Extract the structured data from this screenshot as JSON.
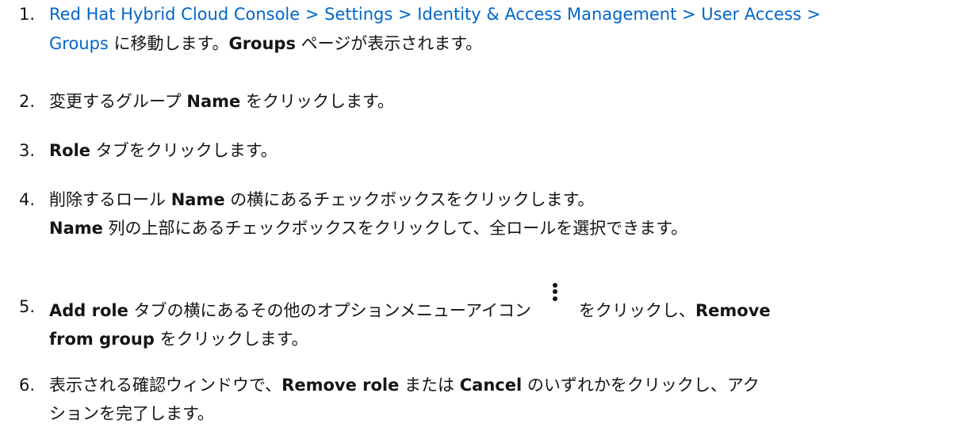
{
  "steps": [
    {
      "number": "1.",
      "breadcrumb": "Red Hat Hybrid Cloud Console > Settings > Identity & Access Management > User Access >",
      "breadcrumb_end": "Groups",
      "text_a": " に移動します。",
      "bold_a": "Groups",
      "text_b": " ページが表示されます。"
    },
    {
      "number": "2.",
      "text_a": "変更するグループ ",
      "bold_a": "Name",
      "text_b": " をクリックします。"
    },
    {
      "number": "3.",
      "bold_a": "Role",
      "text_a": " タブをクリックします。"
    },
    {
      "number": "4.",
      "text_a": "削除するロール ",
      "bold_a": "Name",
      "text_b": " の横にあるチェックボックスをクリックします。",
      "bold_b": "Name",
      "text_c": " 列の上部にあるチェックボックスをクリックして、全ロールを選択できます。"
    },
    {
      "number": "5.",
      "bold_a": "Add role",
      "text_a": " タブの横にあるその他のオプションメニューアイコン",
      "icon": "kebab-menu-icon",
      "text_b": "をクリックし、",
      "bold_b": "Remove",
      "bold_c": "from group",
      "text_c": " をクリックします。"
    },
    {
      "number": "6.",
      "text_a": "表示される確認ウィンドウで、",
      "bold_a": "Remove role",
      "text_b": " または ",
      "bold_b": "Cancel",
      "text_c": " のいずれかをクリックし、アク",
      "text_d": "ションを完了します。"
    }
  ]
}
